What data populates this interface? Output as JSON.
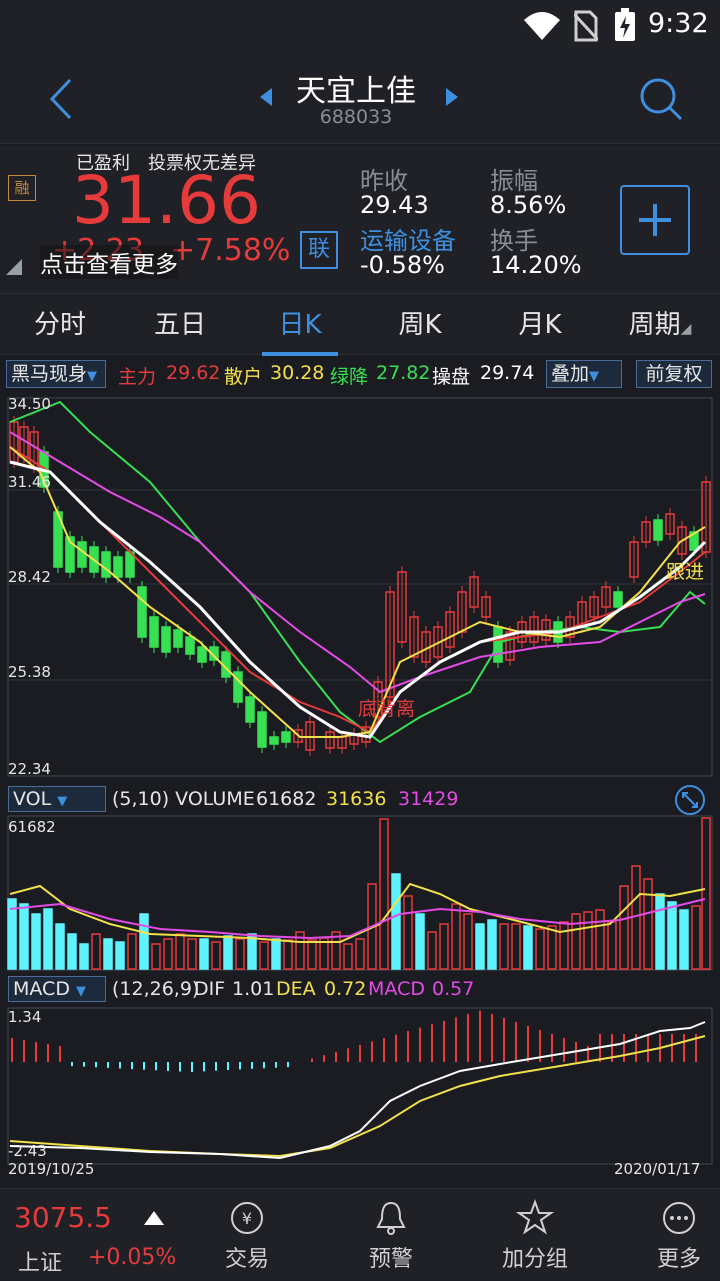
{
  "status_bar": {
    "time": "9:32"
  },
  "header": {
    "stock_name": "天宜上佳",
    "stock_code": "688033"
  },
  "quote": {
    "badge_profit": "已盈利",
    "badge_vote": "投票权无差异",
    "rong_badge": "融",
    "price": "31.66",
    "change": "+2.23",
    "change_pct": "+7.58%",
    "link_badge": "联",
    "tooltip": "点击查看更多",
    "prev_close_label": "昨收",
    "prev_close": "29.43",
    "amplitude_label": "振幅",
    "amplitude": "8.56%",
    "industry_label": "运输设备",
    "industry_change": "-0.58%",
    "turnover_label": "换手",
    "turnover": "14.20%"
  },
  "tabs": [
    "分时",
    "五日",
    "日K",
    "周K",
    "月K",
    "周期"
  ],
  "kline_legend": {
    "indicator": "黑马现身",
    "zl_label": "主力",
    "zl": "29.62",
    "sh_label": "散户",
    "sh": "30.28",
    "lj_label": "绿降",
    "lj": "27.82",
    "cp_label": "操盘",
    "cp": "29.74",
    "overlay_btn": "叠加",
    "adjust_btn": "前复权",
    "ticks": [
      "34.50",
      "31.46",
      "28.42",
      "25.38",
      "22.34"
    ],
    "annot_bottom": "底背离",
    "annot_follow": "跟进"
  },
  "vol_legend": {
    "indicator": "VOL",
    "params": "(5,10) VOLUME",
    "volume": "61682",
    "ma5": "31636",
    "ma10": "31429",
    "tick_top": "61682"
  },
  "macd_legend": {
    "indicator": "MACD",
    "params": "(12,26,9)",
    "dif_label": "DIF",
    "dif": "1.01",
    "dea_label": "DEA",
    "dea": "0.72",
    "macd_label": "MACD",
    "macd": "0.57",
    "tick_top": "1.34",
    "tick_bottom": "-2.43",
    "date_start": "2019/10/25",
    "date_end": "2020/01/17"
  },
  "bottom": {
    "index_value": "3075.5",
    "index_name": "上证",
    "index_change": "+0.05%",
    "nav": [
      "交易",
      "预警",
      "加分组",
      "更多"
    ]
  },
  "colors": {
    "up": "#e63b3b",
    "down": "#37e052",
    "accent": "#3f8fe0",
    "bg": "#1a1c21"
  }
}
